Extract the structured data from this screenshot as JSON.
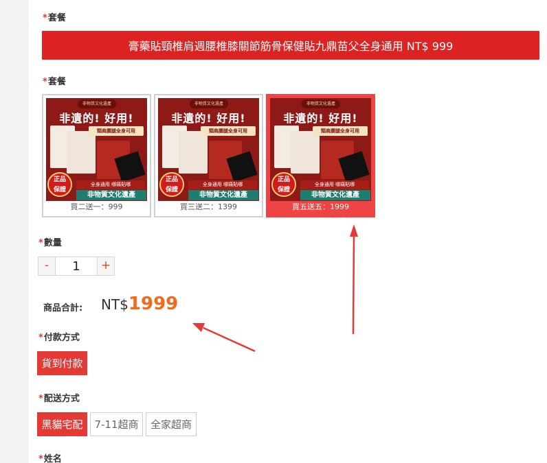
{
  "package_bar": {
    "label": "套餐",
    "selected_name": "膏藥貼頸椎肩週腰椎膝關節筋骨保健貼九鼎苗父全身通用 NT$ 999"
  },
  "package_options": {
    "label": "套餐",
    "items": [
      {
        "caption": "買二送一：999",
        "selected": false,
        "thumb": {
          "top": "非物質文化遺產",
          "headline": "非遺的! 好用!",
          "sub": "頸肩腰腿全身可用",
          "badge_line1": "正品",
          "badge_line2": "保證",
          "tag": "全身通用 哪痛貼哪",
          "banner": "非物質文化遺產"
        }
      },
      {
        "caption": "買三送二：1399",
        "selected": false,
        "thumb": {
          "top": "非物質文化遺產",
          "headline": "非遺的! 好用!",
          "sub": "頸肩腰腿全身可用",
          "badge_line1": "正品",
          "badge_line2": "保證",
          "tag": "全身通用 哪痛貼哪",
          "banner": "非物質文化遺產"
        }
      },
      {
        "caption": "買五送五：1999",
        "selected": true,
        "thumb": {
          "top": "非物質文化遺產",
          "headline": "非遺的! 好用!",
          "sub": "頸肩腰腿全身可用",
          "badge_line1": "正品",
          "badge_line2": "保證",
          "tag": "全身通用 哪痛貼哪",
          "banner": "非物質文化遺產"
        }
      }
    ]
  },
  "quantity": {
    "label": "數量",
    "minus": "-",
    "value": "1",
    "plus": "+"
  },
  "total": {
    "label": "商品合計:",
    "currency": "NT$",
    "amount": "1999"
  },
  "payment": {
    "label": "付款方式",
    "options": [
      "貨到付款"
    ],
    "selected": "貨到付款"
  },
  "shipping": {
    "label": "配送方式",
    "options": [
      "黑貓宅配",
      "7-11超商",
      "全家超商"
    ],
    "selected": "黑貓宅配"
  },
  "name_field": {
    "label": "姓名"
  },
  "colors": {
    "accent_red": "#e53935",
    "bar_red": "#dd2222",
    "price_orange": "#f26a1b",
    "annotation_arrow": "#e53935"
  }
}
